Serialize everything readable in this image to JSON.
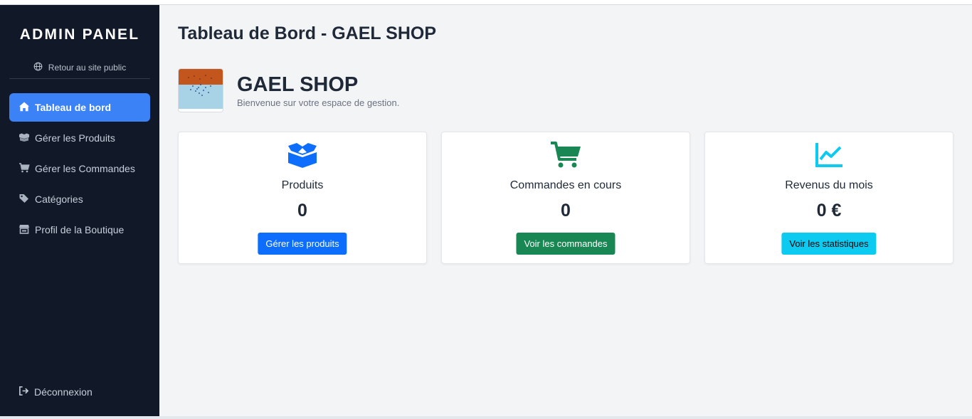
{
  "sidebar": {
    "brand": "ADMIN PANEL",
    "public_link": {
      "label": "Retour au site public",
      "icon": "globe-icon"
    },
    "items": [
      {
        "label": "Tableau de bord",
        "icon": "home-icon",
        "active": true
      },
      {
        "label": "Gérer les Produits",
        "icon": "boxes-icon",
        "active": false
      },
      {
        "label": "Gérer les Commandes",
        "icon": "cart-icon",
        "active": false
      },
      {
        "label": "Catégories",
        "icon": "tags-icon",
        "active": false
      },
      {
        "label": "Profil de la Boutique",
        "icon": "store-icon",
        "active": false
      }
    ],
    "logout": {
      "label": "Déconnexion",
      "icon": "sign-out-icon"
    }
  },
  "main": {
    "title": "Tableau de Bord - GAEL SHOP",
    "shop": {
      "name": "GAEL SHOP",
      "subtitle": "Bienvenue sur votre espace de gestion.",
      "logo": "shop-logo-thumbnail"
    },
    "cards": [
      {
        "title": "Produits",
        "value": "0",
        "button": "Gérer les produits",
        "icon": "box-open-icon",
        "icon_color": "#0d6efd",
        "button_color": "#0d6efd",
        "button_text_color": "#ffffff"
      },
      {
        "title": "Commandes en cours",
        "value": "0",
        "button": "Voir les commandes",
        "icon": "shopping-cart-icon",
        "icon_color": "#198754",
        "button_color": "#198754",
        "button_text_color": "#ffffff"
      },
      {
        "title": "Revenus du mois",
        "value": "0 €",
        "button": "Voir les statistiques",
        "icon": "chart-line-icon",
        "icon_color": "#0dcaf0",
        "button_color": "#0dcaf0",
        "button_text_color": "#000000"
      }
    ]
  },
  "colors": {
    "sidebar_bg": "#111827",
    "active_item": "#3b82f6",
    "page_bg": "#f3f4f6"
  }
}
